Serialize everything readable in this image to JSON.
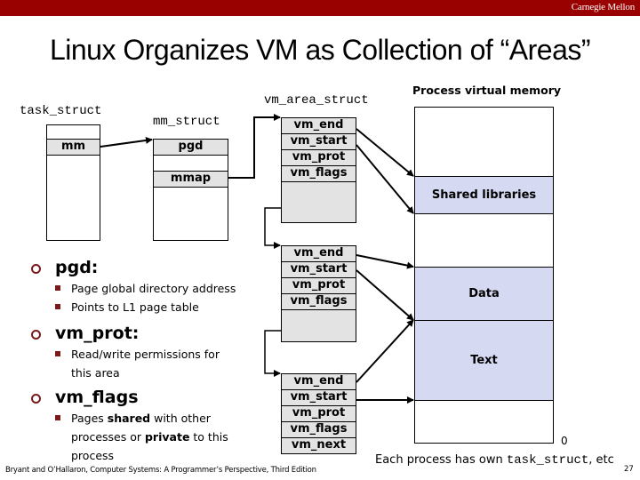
{
  "header": {
    "brand": "Carnegie Mellon",
    "brand_color": "#990000"
  },
  "title": "Linux Organizes VM as Collection of “Areas”",
  "diagram": {
    "task_struct": {
      "label": "task_struct",
      "fields": [
        "",
        "mm"
      ]
    },
    "mm_struct": {
      "label": "mm_struct",
      "fields": [
        "pgd",
        "",
        "mmap"
      ]
    },
    "vm_area_struct_label": "vm_area_struct",
    "vm_areas": [
      {
        "fields": [
          "vm_end",
          "vm_start",
          "vm_prot",
          "vm_flags",
          ""
        ]
      },
      {
        "fields": [
          "vm_end",
          "vm_start",
          "vm_prot",
          "vm_flags",
          ""
        ]
      },
      {
        "fields": [
          "vm_end",
          "vm_start",
          "vm_prot",
          "vm_flags",
          "vm_next"
        ]
      }
    ],
    "process_vm": {
      "label": "Process virtual memory",
      "segments": [
        "Shared libraries",
        "Data",
        "Text"
      ],
      "segment_color": "#d6d9f2",
      "bottom_address": "0"
    }
  },
  "bullets": [
    {
      "heading": "pgd:",
      "items": [
        {
          "text": "Page global directory address"
        },
        {
          "text": "Points to L1 page table"
        }
      ]
    },
    {
      "heading": "vm_prot:",
      "items": [
        {
          "text": "Read/write permissions for this area"
        }
      ]
    },
    {
      "heading": "vm_flags",
      "items": [
        {
          "pre": "Pages ",
          "b1": "shared",
          "mid": " with other processes or ",
          "b2": "private",
          "post": " to this process"
        }
      ]
    }
  ],
  "note": {
    "prefix": "Each process has own ",
    "code": "task_struct",
    "suffix": ", etc"
  },
  "footer": "Bryant and O’Hallaron, Computer Systems: A Programmer’s Perspective, Third Edition",
  "page_number": "27"
}
